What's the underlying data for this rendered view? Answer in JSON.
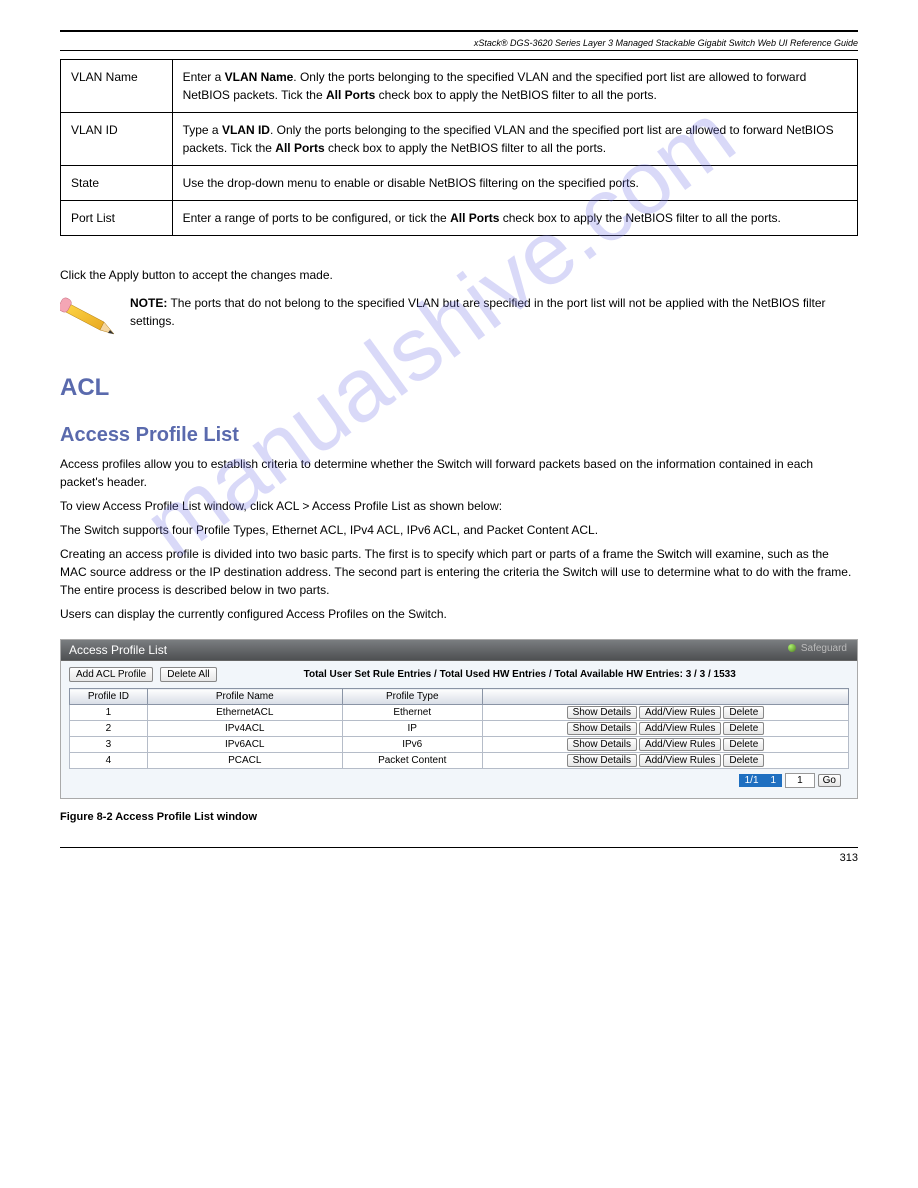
{
  "header": {
    "product_line": "xStack® DGS-3620 Series Layer 3 Managed Stackable Gigabit Switch Web UI Reference Guide"
  },
  "watermark": "manualshive.com",
  "param_table": [
    {
      "label": "VLAN Name",
      "desc_parts": [
        "Enter a ",
        {
          "b": "VLAN Name"
        },
        ". Only the ports belonging to the specified VLAN and the specified port list are allowed to forward NetBIOS packets. Tick the ",
        {
          "b": "All Ports"
        },
        " check box to apply the NetBIOS filter to all the ports."
      ]
    },
    {
      "label": "VLAN ID",
      "desc_parts": [
        "Type a ",
        {
          "b": "VLAN ID"
        },
        ". Only the ports belonging to the specified VLAN and the specified port list are allowed to forward NetBIOS packets. Tick the ",
        {
          "b": "All Ports"
        },
        " check box to apply the NetBIOS filter to all the ports."
      ]
    },
    {
      "label": "State",
      "desc_parts": [
        "Use the drop-down menu to enable or disable NetBIOS filtering on the specified ports."
      ]
    },
    {
      "label": "Port List",
      "desc_parts": [
        "Enter a range of ports to be configured, or tick the ",
        {
          "b": "All Ports"
        },
        " check box to apply the NetBIOS filter to all the ports."
      ]
    }
  ],
  "post_table": "Click the Apply button to accept the changes made.",
  "note": {
    "label": "NOTE:",
    "text": "The ports that do not belong to the specified VLAN but are specified in the port list will not be applied with the NetBIOS filter settings."
  },
  "sections": {
    "acl": {
      "title": "ACL",
      "apl": {
        "title": "Access Profile List",
        "p1": "Access profiles allow you to establish criteria to determine whether the Switch will forward packets based on the information contained in each packet's header.",
        "p2": "To view Access Profile List window, click ACL > Access Profile List as shown below:",
        "p3": "The Switch supports four Profile Types, Ethernet ACL, IPv4 ACL, IPv6 ACL, and Packet Content ACL.",
        "p4": "Creating an access profile is divided into two basic parts. The first is to specify which part or parts of a frame the Switch will examine, such as the MAC source address or the IP destination address. The second part is entering the criteria the Switch will use to determine what to do with the frame. The entire process is described below in two parts.",
        "p5": "Users can display the currently configured Access Profiles on the Switch."
      }
    }
  },
  "app": {
    "title": "Access Profile List",
    "safeguard": "Safeguard",
    "buttons": {
      "add": "Add ACL Profile",
      "delete_all": "Delete All"
    },
    "summary": "Total User Set Rule Entries / Total Used HW Entries / Total Available HW Entries: 3 / 3 / 1533",
    "columns": [
      "Profile ID",
      "Profile Name",
      "Profile Type"
    ],
    "rows": [
      {
        "id": "1",
        "name": "EthernetACL",
        "type": "Ethernet"
      },
      {
        "id": "2",
        "name": "IPv4ACL",
        "type": "IP"
      },
      {
        "id": "3",
        "name": "IPv6ACL",
        "type": "IPv6"
      },
      {
        "id": "4",
        "name": "PCACL",
        "type": "Packet Content"
      }
    ],
    "row_buttons": {
      "details": "Show Details",
      "addview": "Add/View Rules",
      "delete": "Delete"
    },
    "pager": {
      "label": "1/1",
      "page": "1",
      "go": "Go"
    }
  },
  "figure_caption": "Figure 8-2 Access Profile List window",
  "footer": {
    "page": "313"
  }
}
